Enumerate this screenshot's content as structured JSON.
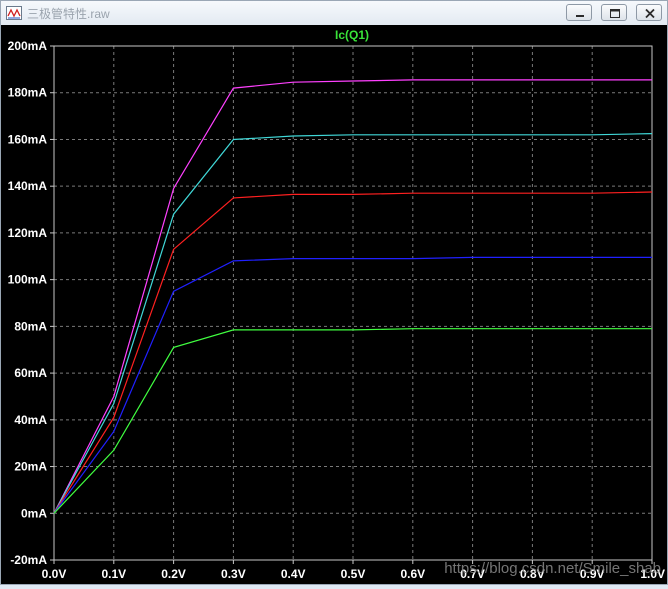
{
  "window": {
    "title": "三极管特性.raw",
    "buttons": {
      "minimize_icon": "minimize-icon",
      "maximize_icon": "maximize-icon",
      "close_icon": "close-icon"
    }
  },
  "watermark": "https://blog.csdn.net/Smile_shab",
  "colors": {
    "background": "#000000",
    "grid": "#7a7a7a",
    "axis_text": "#ffffff",
    "title": "#39e339"
  },
  "chart_data": {
    "type": "line",
    "title": "Ic(Q1)",
    "xlabel": "",
    "ylabel": "",
    "xlim": [
      0,
      1.0
    ],
    "ylim": [
      -20,
      200
    ],
    "grid": true,
    "x_ticks": [
      "0.0V",
      "0.1V",
      "0.2V",
      "0.3V",
      "0.4V",
      "0.5V",
      "0.6V",
      "0.7V",
      "0.8V",
      "0.9V",
      "1.0V"
    ],
    "y_ticks": [
      "-20mA",
      "0mA",
      "20mA",
      "40mA",
      "60mA",
      "80mA",
      "100mA",
      "120mA",
      "140mA",
      "160mA",
      "180mA",
      "200mA"
    ],
    "x_tick_values": [
      0,
      0.1,
      0.2,
      0.3,
      0.4,
      0.5,
      0.6,
      0.7,
      0.8,
      0.9,
      1.0
    ],
    "y_tick_values": [
      -20,
      0,
      20,
      40,
      60,
      80,
      100,
      120,
      140,
      160,
      180,
      200
    ],
    "series": [
      {
        "color": "#ff40ff",
        "x": [
          0,
          0.1,
          0.2,
          0.3,
          0.4,
          0.5,
          0.6,
          0.7,
          0.8,
          0.9,
          1.0
        ],
        "y": [
          0,
          50,
          139,
          182,
          184.5,
          185,
          185.5,
          185.5,
          185.5,
          185.5,
          185.5
        ]
      },
      {
        "color": "#40d8d8",
        "x": [
          0,
          0.1,
          0.2,
          0.3,
          0.4,
          0.5,
          0.6,
          0.7,
          0.8,
          0.9,
          1.0
        ],
        "y": [
          0,
          47,
          128,
          160,
          161.5,
          162,
          162,
          162,
          162,
          162,
          162.5
        ]
      },
      {
        "color": "#ff2020",
        "x": [
          0,
          0.1,
          0.2,
          0.3,
          0.4,
          0.5,
          0.6,
          0.7,
          0.8,
          0.9,
          1.0
        ],
        "y": [
          0,
          41,
          113,
          135,
          136.5,
          136.5,
          137,
          137,
          137,
          137,
          137.5
        ]
      },
      {
        "color": "#2020ff",
        "x": [
          0,
          0.1,
          0.2,
          0.3,
          0.4,
          0.5,
          0.6,
          0.7,
          0.8,
          0.9,
          1.0
        ],
        "y": [
          0,
          35,
          95,
          108,
          109,
          109,
          109,
          109.5,
          109.5,
          109.5,
          109.5
        ]
      },
      {
        "color": "#40ff40",
        "x": [
          0,
          0.1,
          0.2,
          0.3,
          0.4,
          0.5,
          0.6,
          0.7,
          0.8,
          0.9,
          1.0
        ],
        "y": [
          0,
          27,
          71,
          78.5,
          78.5,
          78.5,
          79,
          79,
          79,
          79,
          79
        ]
      }
    ]
  }
}
